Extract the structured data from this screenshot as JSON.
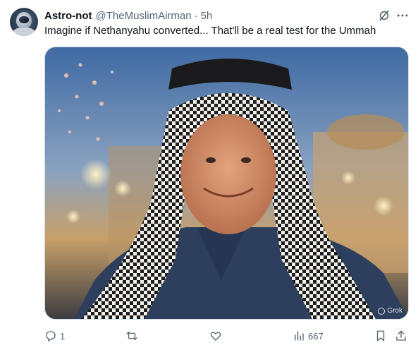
{
  "tweet": {
    "display_name": "Astro-not",
    "handle": "@TheMuslimAirman",
    "separator": "·",
    "timestamp": "5h",
    "text": "Imagine if Nethanyahu converted... That'll be a real test for the Ummah"
  },
  "media": {
    "watermark": "Grok"
  },
  "actions": {
    "reply_count": "1",
    "retweet_count": "",
    "like_count": "",
    "view_count": "667"
  },
  "icons": {
    "grok": "grok-icon",
    "more": "more-icon",
    "reply": "reply-icon",
    "retweet": "retweet-icon",
    "like": "heart-icon",
    "views": "views-icon",
    "bookmark": "bookmark-icon",
    "share": "share-icon"
  },
  "colors": {
    "text_primary": "#0f1419",
    "text_secondary": "#536471",
    "border": "#cfd9de"
  }
}
